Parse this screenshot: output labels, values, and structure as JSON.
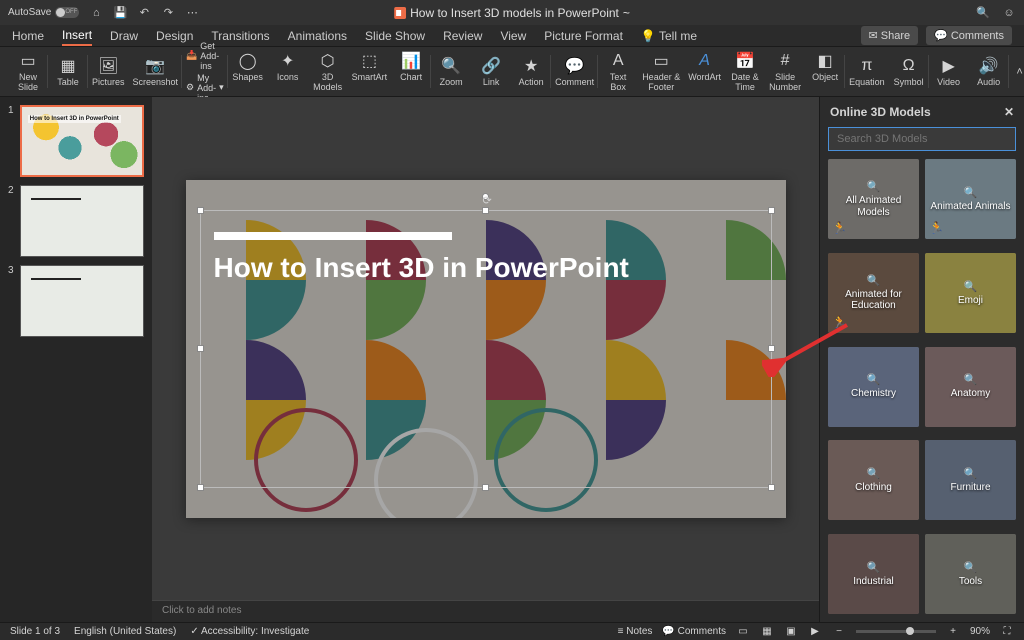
{
  "titlebar": {
    "autosave_label": "AutoSave",
    "autosave_state": "OFF",
    "doc_title": "How to Insert 3D models in PowerPoint",
    "doc_suffix": "~"
  },
  "tabs": {
    "items": [
      "Home",
      "Insert",
      "Draw",
      "Design",
      "Transitions",
      "Animations",
      "Slide Show",
      "Review",
      "View",
      "Picture Format"
    ],
    "tell_me": "Tell me",
    "active_index": 1,
    "share": "Share",
    "comments": "Comments"
  },
  "ribbon": {
    "new_slide": "New\nSlide",
    "table": "Table",
    "pictures": "Pictures",
    "screenshot": "Screenshot",
    "get_addins": "Get Add-ins",
    "my_addins": "My Add-ins",
    "shapes": "Shapes",
    "icons": "Icons",
    "models3d": "3D\nModels",
    "smartart": "SmartArt",
    "chart": "Chart",
    "zoom": "Zoom",
    "link": "Link",
    "action": "Action",
    "comment": "Comment",
    "textbox": "Text\nBox",
    "header_footer": "Header &\nFooter",
    "wordart": "WordArt",
    "date_time": "Date &\nTime",
    "slide_number": "Slide\nNumber",
    "object": "Object",
    "equation": "Equation",
    "symbol": "Symbol",
    "video": "Video",
    "audio": "Audio"
  },
  "thumbs": {
    "active_index": 0,
    "items": [
      {
        "num": "1",
        "title": "How to Insert 3D in PowerPoint"
      },
      {
        "num": "2"
      },
      {
        "num": "3"
      }
    ]
  },
  "slide": {
    "title": "How to Insert 3D in PowerPoint"
  },
  "notes_placeholder": "Click to add notes",
  "sidepanel": {
    "title": "Online 3D Models",
    "search_placeholder": "Search 3D Models",
    "categories": [
      {
        "label": "All Animated Models",
        "anim": true,
        "bg": "#6d6b68"
      },
      {
        "label": "Animated Animals",
        "anim": true,
        "bg": "#6b7a82"
      },
      {
        "label": "Animated for Education",
        "anim": true,
        "bg": "#5b4a3e"
      },
      {
        "label": "Emoji",
        "anim": false,
        "bg": "#8a8240"
      },
      {
        "label": "Chemistry",
        "anim": false,
        "bg": "#5a647a"
      },
      {
        "label": "Anatomy",
        "anim": false,
        "bg": "#6b5a5a"
      },
      {
        "label": "Clothing",
        "anim": false,
        "bg": "#6a5a56"
      },
      {
        "label": "Furniture",
        "anim": false,
        "bg": "#566070"
      },
      {
        "label": "Industrial",
        "anim": false,
        "bg": "#5a4a48"
      },
      {
        "label": "Tools",
        "anim": false,
        "bg": "#60605a"
      }
    ]
  },
  "statusbar": {
    "slide_of": "Slide 1 of 3",
    "language": "English (United States)",
    "accessibility": "Accessibility: Investigate",
    "notes": "Notes",
    "comments": "Comments",
    "zoom": "90%"
  },
  "colors": {
    "accent": "#ed6c47",
    "ring": "#4a90d9"
  }
}
